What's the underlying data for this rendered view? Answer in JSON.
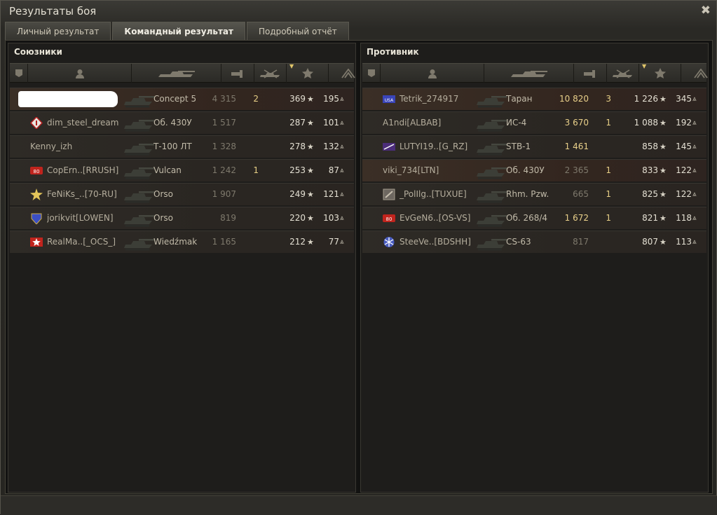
{
  "window": {
    "title": "Результаты боя"
  },
  "tabs": [
    {
      "label": "Личный результат",
      "active": false
    },
    {
      "label": "Командный результат",
      "active": true
    },
    {
      "label": "Подробный отчёт",
      "active": false
    }
  ],
  "columns": [
    "platoon-icon",
    "player-icon",
    "tank-icon",
    "damage-icon",
    "kills-icon",
    "experience-star-icon",
    "credits-icon"
  ],
  "allies": {
    "title": "Союзники",
    "rows": [
      {
        "name": "",
        "censored": true,
        "tank": "Concept 5",
        "damage": "4 315",
        "kills": "2",
        "exp": "369",
        "credits": "195",
        "icon": ""
      },
      {
        "name": "dim_steel_dream",
        "tank": "Об. 430У",
        "damage": "1 517",
        "kills": "",
        "exp": "287",
        "credits": "101",
        "icon": "diamond"
      },
      {
        "name": "Kenny_izh",
        "tank": "Т-100 ЛТ",
        "damage": "1 328",
        "kills": "",
        "exp": "278",
        "credits": "132",
        "icon": ""
      },
      {
        "name": "CopErn..[RRUSH]",
        "tank": "Vulcan",
        "damage": "1 242",
        "kills": "1",
        "exp": "253",
        "credits": "87",
        "icon": "red80"
      },
      {
        "name": "FeNiKs_..[70-RU]",
        "tank": "Orso",
        "damage": "1 907",
        "kills": "",
        "exp": "249",
        "credits": "121",
        "icon": "star"
      },
      {
        "name": "jorikvit[LOWEN]",
        "tank": "Orso",
        "damage": "819",
        "kills": "",
        "exp": "220",
        "credits": "103",
        "icon": "blueshield"
      },
      {
        "name": "RealMa..[_OCS_]",
        "tank": "Wiedźmak",
        "damage": "1 165",
        "kills": "",
        "exp": "212",
        "credits": "77",
        "icon": "redstar"
      }
    ]
  },
  "enemies": {
    "title": "Противник",
    "rows": [
      {
        "name": "Tetrik_274917",
        "tank": "Таран",
        "damage": "10 820",
        "kills": "3",
        "exp": "1 226",
        "credits": "345",
        "icon": "usa",
        "badge": "USA"
      },
      {
        "name": "A1ndi[ALBAB]",
        "tank": "ИС-4",
        "damage": "3 670",
        "kills": "1",
        "exp": "1 088",
        "credits": "192",
        "icon": ""
      },
      {
        "name": "LUTYI19..[G_RZ]",
        "tank": "STB-1",
        "damage": "1 461",
        "kills": "",
        "exp": "858",
        "credits": "145",
        "icon": "purple"
      },
      {
        "name": "viki_734[LTN]",
        "tank": "Об. 430У",
        "damage": "2 365",
        "kills": "1",
        "exp": "833",
        "credits": "122",
        "icon": ""
      },
      {
        "name": "_PolIlg..[TUXUE]",
        "tank": "Rhm. Pzw.",
        "damage": "665",
        "kills": "1",
        "exp": "825",
        "credits": "122",
        "icon": "shield"
      },
      {
        "name": "EvGeN6..[OS-VS]",
        "tank": "Об. 268/4",
        "damage": "1 672",
        "kills": "1",
        "exp": "821",
        "credits": "118",
        "icon": "red80"
      },
      {
        "name": "SteeVe..[BDSHH]",
        "tank": "CS-63",
        "damage": "817",
        "kills": "",
        "exp": "807",
        "credits": "113",
        "icon": "snow"
      }
    ]
  },
  "colors": {
    "gold": "#e9d08a",
    "row_highlight": "#3b2f26",
    "accent_sort": "#e0c56a"
  }
}
